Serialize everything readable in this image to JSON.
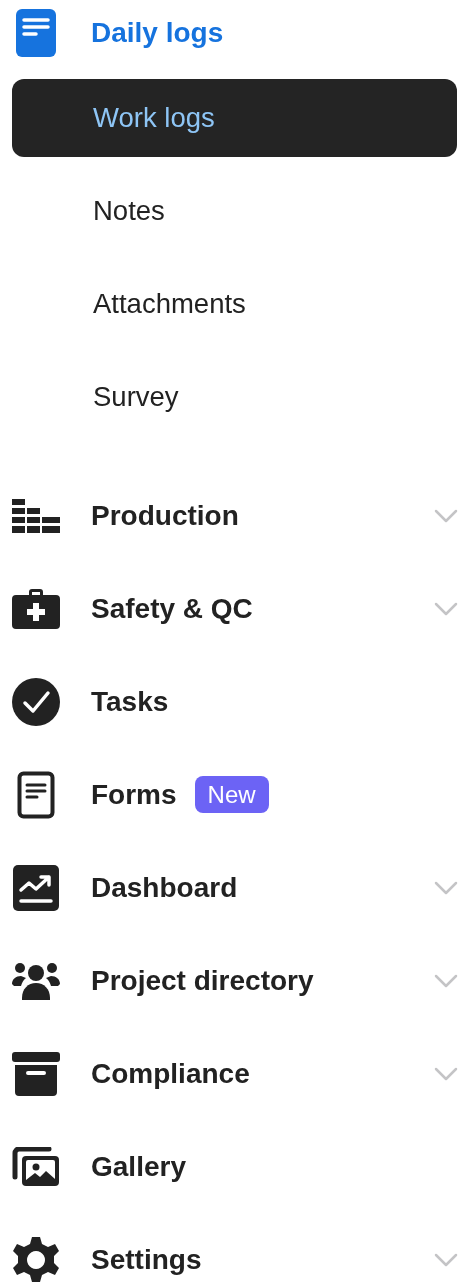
{
  "section": {
    "label": "Daily logs",
    "items": [
      {
        "label": "Work logs",
        "selected": true
      },
      {
        "label": "Notes",
        "selected": false
      },
      {
        "label": "Attachments",
        "selected": false
      },
      {
        "label": "Survey",
        "selected": false
      }
    ]
  },
  "menu": [
    {
      "label": "Production",
      "chevron": true
    },
    {
      "label": "Safety & QC",
      "chevron": true
    },
    {
      "label": "Tasks",
      "chevron": false
    },
    {
      "label": "Forms",
      "chevron": false,
      "badge": "New"
    },
    {
      "label": "Dashboard",
      "chevron": true
    },
    {
      "label": "Project directory",
      "chevron": true
    },
    {
      "label": "Compliance",
      "chevron": true
    },
    {
      "label": "Gallery",
      "chevron": false
    },
    {
      "label": "Settings",
      "chevron": true
    }
  ]
}
